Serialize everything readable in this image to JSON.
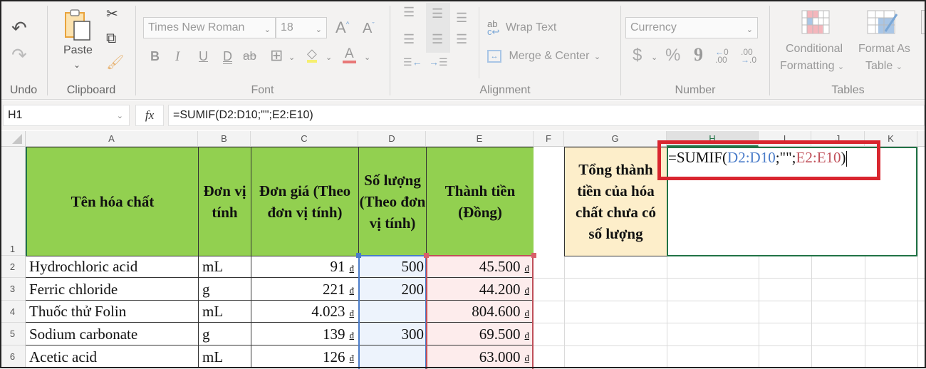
{
  "ribbon": {
    "undo": {
      "label": "Undo"
    },
    "clipboard": {
      "label": "Clipboard",
      "paste": "Paste"
    },
    "font": {
      "label": "Font",
      "font_name": "Times New Roman",
      "font_size": "18",
      "buttons": [
        "B",
        "I",
        "U",
        "D",
        "ab"
      ]
    },
    "alignment": {
      "label": "Alignment",
      "wrap_text": "Wrap Text",
      "merge_center": "Merge & Center"
    },
    "number": {
      "label": "Number",
      "format": "Currency",
      "currency_symbol": "$",
      "percent": "%",
      "comma": "9",
      "increase_decimal": ".00",
      "decrease_decimal": ".0"
    },
    "tables": {
      "label": "Tables",
      "conditional_formatting_line1": "Conditional",
      "conditional_formatting_line2": "Formatting",
      "format_as_table_line1": "Format As",
      "format_as_table_line2": "Table"
    }
  },
  "formula_bar": {
    "name_box": "H1",
    "fx": "fx",
    "formula": "=SUMIF(D2:D10;\"\";E2:E10)"
  },
  "columns": [
    "A",
    "B",
    "C",
    "D",
    "E",
    "F",
    "G",
    "H",
    "I",
    "J",
    "K"
  ],
  "rows": [
    "1",
    "2",
    "3",
    "4",
    "5",
    "6"
  ],
  "headers": {
    "A": "Tên hóa chất",
    "B": "Đơn vị tính",
    "C": "Đơn giá (Theo đơn vị tính)",
    "D": "Số lượng (Theo đơn vị tính)",
    "E": "Thành tiền (Đồng)",
    "G": "Tổng thành tiền của hóa chất chưa có số lượng"
  },
  "currency_symbol": "đ",
  "table": [
    {
      "name": "Hydrochloric acid",
      "unit": "mL",
      "price": "91",
      "qty": "500",
      "total": "45.500"
    },
    {
      "name": "Ferric chloride",
      "unit": "g",
      "price": "221",
      "qty": "200",
      "total": "44.200"
    },
    {
      "name": "Thuốc thử Folin",
      "unit": "mL",
      "price": "4.023",
      "qty": "",
      "total": "804.600"
    },
    {
      "name": "Sodium carbonate",
      "unit": "g",
      "price": "139",
      "qty": "300",
      "total": "69.500"
    },
    {
      "name": "Acetic acid",
      "unit": "mL",
      "price": "126",
      "qty": "",
      "total": "63.000"
    }
  ],
  "edit_cell": {
    "prefix": "=SUMIF(",
    "arg1": "D2:D10",
    "sep1": ";\"\";",
    "arg2": "E2:E10",
    "suffix": ")"
  },
  "colors": {
    "header_green": "#92d050",
    "g_fill": "#fdeeca",
    "range_blue": "#4a7cc9",
    "range_red": "#c0505a",
    "highlight_red": "#d9262f",
    "active_green": "#217346"
  }
}
